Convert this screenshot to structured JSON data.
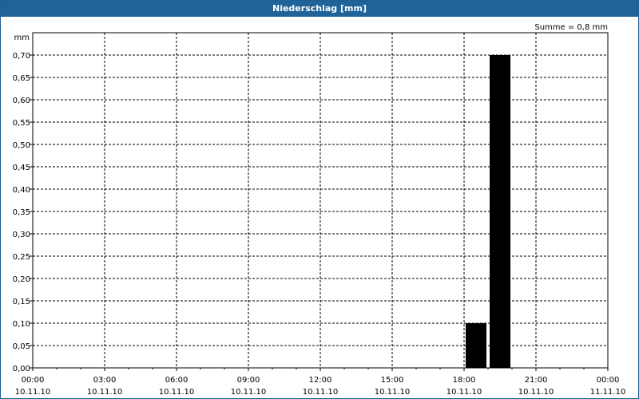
{
  "window": {
    "title": "Niederschlag [mm]"
  },
  "colors": {
    "title_bar": "#1f6398",
    "bars": "#000000",
    "grid": "#000000"
  },
  "chart_data": {
    "type": "bar",
    "ylabel": "mm",
    "ylim": [
      0,
      0.75
    ],
    "yticks": [
      "0,00",
      "0,05",
      "0,10",
      "0,15",
      "0,20",
      "0,25",
      "0,30",
      "0,35",
      "0,40",
      "0,45",
      "0,50",
      "0,55",
      "0,60",
      "0,65",
      "0,70"
    ],
    "ytick_values": [
      0,
      0.05,
      0.1,
      0.15,
      0.2,
      0.25,
      0.3,
      0.35,
      0.4,
      0.45,
      0.5,
      0.55,
      0.6,
      0.65,
      0.7
    ],
    "xlim": [
      "2010-11-10T00:00",
      "2010-11-11T00:00"
    ],
    "xticks": [
      {
        "time": "00:00",
        "date": "10.11.10",
        "hour": 0
      },
      {
        "time": "03:00",
        "date": "10.11.10",
        "hour": 3
      },
      {
        "time": "06:00",
        "date": "10.11.10",
        "hour": 6
      },
      {
        "time": "09:00",
        "date": "10.11.10",
        "hour": 9
      },
      {
        "time": "12:00",
        "date": "10.11.10",
        "hour": 12
      },
      {
        "time": "15:00",
        "date": "10.11.10",
        "hour": 15
      },
      {
        "time": "18:00",
        "date": "10.11.10",
        "hour": 18
      },
      {
        "time": "21:00",
        "date": "10.11.10",
        "hour": 21
      },
      {
        "time": "00:00",
        "date": "11.11.10",
        "hour": 24
      }
    ],
    "bars": [
      {
        "start": "2010-11-10T18:00",
        "end": "2010-11-10T19:00",
        "value": 0.1
      },
      {
        "start": "2010-11-10T19:00",
        "end": "2010-11-10T20:00",
        "value": 0.7
      }
    ],
    "annotation": "Summe = 0,8 mm",
    "grid": true
  }
}
